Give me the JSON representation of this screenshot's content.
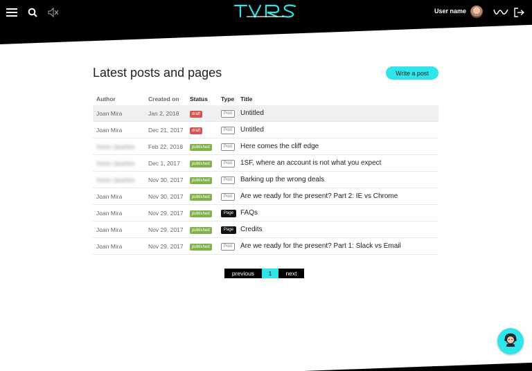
{
  "header": {
    "user_name": "User name",
    "icons": [
      "menu-icon",
      "search-icon",
      "mute-icon",
      "logo",
      "avatar",
      "wave-icon",
      "logout-icon"
    ],
    "accent_color": "#2ee6ea"
  },
  "main": {
    "title": "Latest posts and pages",
    "write_button": "Write a post"
  },
  "table": {
    "columns": [
      "Author",
      "Created on",
      "Status",
      "Type",
      "Title"
    ],
    "rows": [
      {
        "author": "Joan Mira",
        "created": "Jan 2, 2018",
        "status": "draft",
        "type": "Post",
        "title": "Untitled"
      },
      {
        "author": "Joan Mira",
        "created": "Dec 21, 2017",
        "status": "draft",
        "type": "Post",
        "title": "Untitled"
      },
      {
        "author": "Gwen Sparkes",
        "created": "Feb 22, 2018",
        "status": "published",
        "type": "Post",
        "title": "Here comes the cliff edge"
      },
      {
        "author": "Gwen Sparkes",
        "created": "Dec 1, 2017",
        "status": "published",
        "type": "Post",
        "title": "1SF, where an account is not what you expect"
      },
      {
        "author": "Gwen Sparkes",
        "created": "Nov 30, 2017",
        "status": "published",
        "type": "Post",
        "title": "Barking up the wrong deals"
      },
      {
        "author": "Joan Mira",
        "created": "Nov 30, 2017",
        "status": "published",
        "type": "Post",
        "title": "Are we ready for the present? Part 2: IE vs Chrome"
      },
      {
        "author": "Joan Mira",
        "created": "Nov 29, 2017",
        "status": "published",
        "type": "Page",
        "title": "FAQs"
      },
      {
        "author": "Joan Mira",
        "created": "Nov 29, 2017",
        "status": "published",
        "type": "Page",
        "title": "Credits"
      },
      {
        "author": "Joan Mira",
        "created": "Nov 29, 2017",
        "status": "published",
        "type": "Post",
        "title": "Are we ready for the present? Part 1: Slack vs Email"
      }
    ]
  },
  "pagination": {
    "previous": "previous",
    "current": "1",
    "next": "next"
  },
  "status_colors": {
    "draft": "#d9534f",
    "published": "#7fb24a"
  },
  "support_button_icon": "support-agent-icon"
}
